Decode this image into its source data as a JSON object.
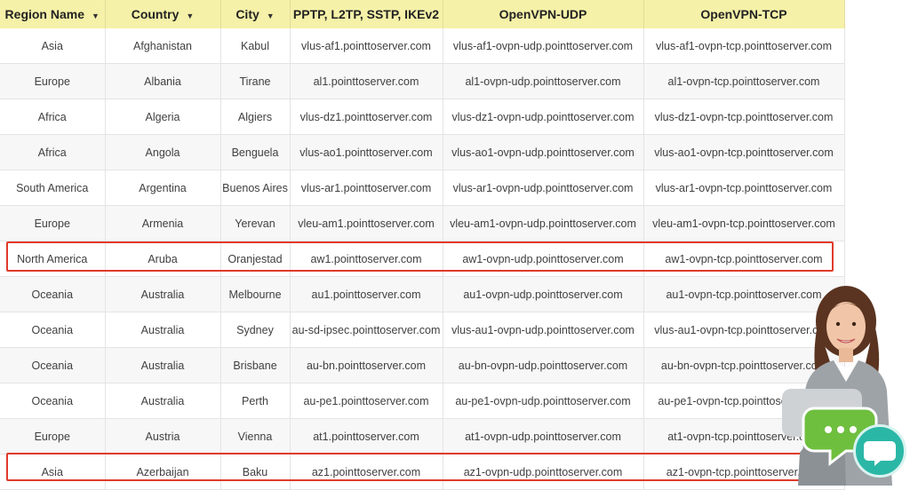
{
  "table": {
    "headers": [
      {
        "label": "Region Name",
        "sortable": true
      },
      {
        "label": "Country",
        "sortable": true
      },
      {
        "label": "City",
        "sortable": true
      },
      {
        "label": "PPTP, L2TP, SSTP, IKEv2",
        "sortable": false
      },
      {
        "label": "OpenVPN-UDP",
        "sortable": false
      },
      {
        "label": "OpenVPN-TCP",
        "sortable": false
      }
    ],
    "rows": [
      [
        "Asia",
        "Afghanistan",
        "Kabul",
        "vlus-af1.pointtoserver.com",
        "vlus-af1-ovpn-udp.pointtoserver.com",
        "vlus-af1-ovpn-tcp.pointtoserver.com"
      ],
      [
        "Europe",
        "Albania",
        "Tirane",
        "al1.pointtoserver.com",
        "al1-ovpn-udp.pointtoserver.com",
        "al1-ovpn-tcp.pointtoserver.com"
      ],
      [
        "Africa",
        "Algeria",
        "Algiers",
        "vlus-dz1.pointtoserver.com",
        "vlus-dz1-ovpn-udp.pointtoserver.com",
        "vlus-dz1-ovpn-tcp.pointtoserver.com"
      ],
      [
        "Africa",
        "Angola",
        "Benguela",
        "vlus-ao1.pointtoserver.com",
        "vlus-ao1-ovpn-udp.pointtoserver.com",
        "vlus-ao1-ovpn-tcp.pointtoserver.com"
      ],
      [
        "South America",
        "Argentina",
        "Buenos Aires",
        "vlus-ar1.pointtoserver.com",
        "vlus-ar1-ovpn-udp.pointtoserver.com",
        "vlus-ar1-ovpn-tcp.pointtoserver.com"
      ],
      [
        "Europe",
        "Armenia",
        "Yerevan",
        "vleu-am1.pointtoserver.com",
        "vleu-am1-ovpn-udp.pointtoserver.com",
        "vleu-am1-ovpn-tcp.pointtoserver.com"
      ],
      [
        "North America",
        "Aruba",
        "Oranjestad",
        "aw1.pointtoserver.com",
        "aw1-ovpn-udp.pointtoserver.com",
        "aw1-ovpn-tcp.pointtoserver.com"
      ],
      [
        "Oceania",
        "Australia",
        "Melbourne",
        "au1.pointtoserver.com",
        "au1-ovpn-udp.pointtoserver.com",
        "au1-ovpn-tcp.pointtoserver.com"
      ],
      [
        "Oceania",
        "Australia",
        "Sydney",
        "au-sd-ipsec.pointtoserver.com",
        "vlus-au1-ovpn-udp.pointtoserver.com",
        "vlus-au1-ovpn-tcp.pointtoserver.com"
      ],
      [
        "Oceania",
        "Australia",
        "Brisbane",
        "au-bn.pointtoserver.com",
        "au-bn-ovpn-udp.pointtoserver.com",
        "au-bn-ovpn-tcp.pointtoserver.com"
      ],
      [
        "Oceania",
        "Australia",
        "Perth",
        "au-pe1.pointtoserver.com",
        "au-pe1-ovpn-udp.pointtoserver.com",
        "au-pe1-ovpn-tcp.pointtoserver.com"
      ],
      [
        "Europe",
        "Austria",
        "Vienna",
        "at1.pointtoserver.com",
        "at1-ovpn-udp.pointtoserver.com",
        "at1-ovpn-tcp.pointtoserver.com"
      ],
      [
        "Asia",
        "Azerbaijan",
        "Baku",
        "az1.pointtoserver.com",
        "az1-ovpn-udp.pointtoserver.com",
        "az1-ovpn-tcp.pointtoserver.com"
      ]
    ],
    "highlighted_rows": [
      6,
      12
    ]
  },
  "sort_icon": "triangle-down-icon",
  "chat_widget": {
    "icon": "chat-bubble-icon"
  },
  "colors": {
    "header_bg": "#f5f1a8",
    "highlight": "#e03a2a",
    "chat": "#2bb7a6"
  }
}
